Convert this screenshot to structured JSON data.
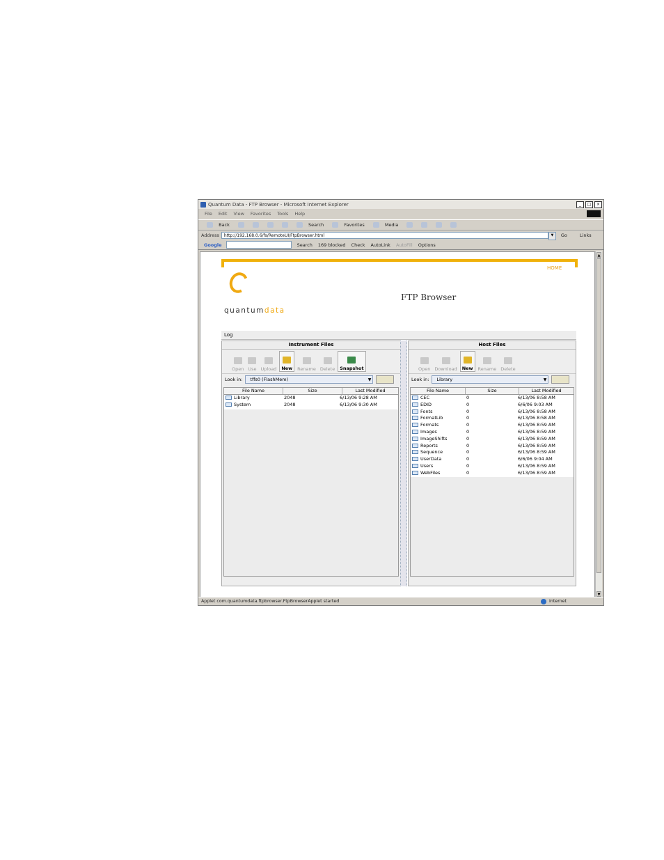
{
  "browser": {
    "title": "Quantum Data - FTP Browser - Microsoft Internet Explorer",
    "menu": [
      "File",
      "Edit",
      "View",
      "Favorites",
      "Tools",
      "Help"
    ],
    "toolbar": [
      "Back",
      "Search",
      "Favorites",
      "Media"
    ],
    "address_label": "Address",
    "address": "http://192.168.0.6/fs/RemoteUI/FtpBrowser.html",
    "go_label": "Go",
    "links_label": "Links",
    "google": {
      "logo": "Google",
      "search": "Search",
      "blocked": "169 blocked",
      "check": "Check",
      "autolink": "AutoLink",
      "autofill": "AutoFill",
      "options": "Options"
    },
    "status": "Applet com.quantumdata.ftpbrowser.FtpBrowserApplet started",
    "zone": "Internet"
  },
  "page": {
    "home_link": "HOME",
    "logo_a": "quantum",
    "logo_b": "data",
    "title": "FTP Browser",
    "log_label": "Log"
  },
  "instrument": {
    "header": "Instrument Files",
    "buttons": [
      "Open",
      "Use",
      "Upload",
      "New",
      "Rename",
      "Delete",
      "Snapshot"
    ],
    "look_in_label": "Look in:",
    "look_in_value": "tffs0  (FlashMem)",
    "columns": [
      "File Name",
      "Size",
      "Last Modified"
    ],
    "rows": [
      {
        "name": "Library",
        "size": "2048",
        "modified": "6/13/06 9:28 AM"
      },
      {
        "name": "System",
        "size": "2048",
        "modified": "6/13/06 9:30 AM"
      }
    ]
  },
  "host": {
    "header": "Host Files",
    "buttons": [
      "Open",
      "Download",
      "New",
      "Rename",
      "Delete"
    ],
    "look_in_label": "Look in:",
    "look_in_value": "Library",
    "columns": [
      "File Name",
      "Size",
      "Last Modified"
    ],
    "rows": [
      {
        "name": "CEC",
        "size": "0",
        "modified": "6/13/06 8:58 AM"
      },
      {
        "name": "EDID",
        "size": "0",
        "modified": "6/6/06 9:03 AM"
      },
      {
        "name": "Fonts",
        "size": "0",
        "modified": "6/13/06 8:58 AM"
      },
      {
        "name": "FormatLib",
        "size": "0",
        "modified": "6/13/06 8:58 AM"
      },
      {
        "name": "Formats",
        "size": "0",
        "modified": "6/13/06 8:59 AM"
      },
      {
        "name": "Images",
        "size": "0",
        "modified": "6/13/06 8:59 AM"
      },
      {
        "name": "ImageShifts",
        "size": "0",
        "modified": "6/13/06 8:59 AM"
      },
      {
        "name": "Reports",
        "size": "0",
        "modified": "6/13/06 8:59 AM"
      },
      {
        "name": "Sequence",
        "size": "0",
        "modified": "6/13/06 8:59 AM"
      },
      {
        "name": "UserData",
        "size": "0",
        "modified": "6/6/06 9:04 AM"
      },
      {
        "name": "Users",
        "size": "0",
        "modified": "6/13/06 8:59 AM"
      },
      {
        "name": "WebFiles",
        "size": "0",
        "modified": "6/13/06 8:59 AM"
      }
    ]
  }
}
